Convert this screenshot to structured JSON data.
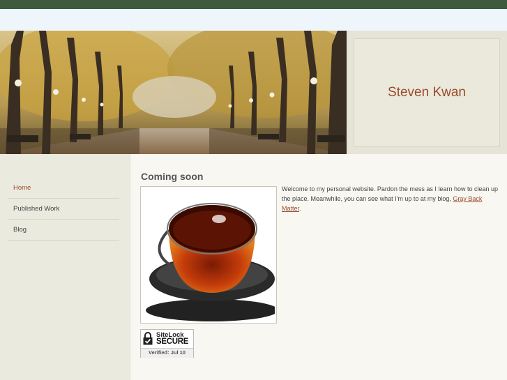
{
  "header": {
    "site_title": "Steven Kwan"
  },
  "nav": {
    "items": [
      {
        "label": "Home",
        "active": true
      },
      {
        "label": "Published Work",
        "active": false
      },
      {
        "label": "Blog",
        "active": false
      }
    ]
  },
  "main": {
    "heading": "Coming soon",
    "intro_text": "Welcome to my personal website. Pardon the mess as I learn how to clean up the place. Meanwhile, you can see what I'm up to at my blog, ",
    "blog_link": "Gray Back Matter",
    "intro_end": "."
  },
  "badge": {
    "brand": "SiteLock",
    "secure": "SECURE",
    "verified": "Verified: Jul  10"
  },
  "colors": {
    "topbar": "#3d5a3f",
    "accent": "#9a4a2a",
    "sidebar": "#ebeadf"
  },
  "icons": {
    "badge_lock": "padlock-check-icon"
  }
}
